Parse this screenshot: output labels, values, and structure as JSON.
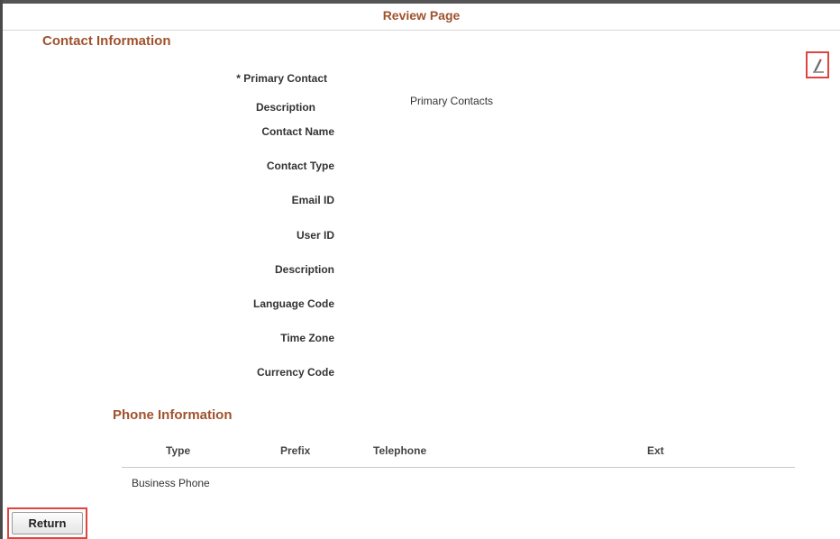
{
  "header": {
    "title": "Review Page"
  },
  "contact": {
    "section_title": "Contact Information",
    "edit_icon": "pencil-edit-icon",
    "fields": {
      "primary_contact_label": "* Primary Contact",
      "description_label": "Description",
      "description_value": "Primary Contacts",
      "contact_name_label": "Contact Name",
      "contact_type_label": "Contact Type",
      "email_id_label": "Email ID",
      "user_id_label": "User ID",
      "description2_label": "Description",
      "language_code_label": "Language Code",
      "time_zone_label": "Time Zone",
      "currency_code_label": "Currency Code"
    }
  },
  "phone": {
    "section_title": "Phone Information",
    "columns": [
      "Type",
      "Prefix",
      "Telephone",
      "Ext"
    ],
    "rows": [
      {
        "type": "Business Phone",
        "prefix": "",
        "telephone": "",
        "ext": ""
      }
    ]
  },
  "footer": {
    "return_label": "Return"
  },
  "colors": {
    "accent": "#a0522d",
    "highlight_border": "#e0443e"
  }
}
